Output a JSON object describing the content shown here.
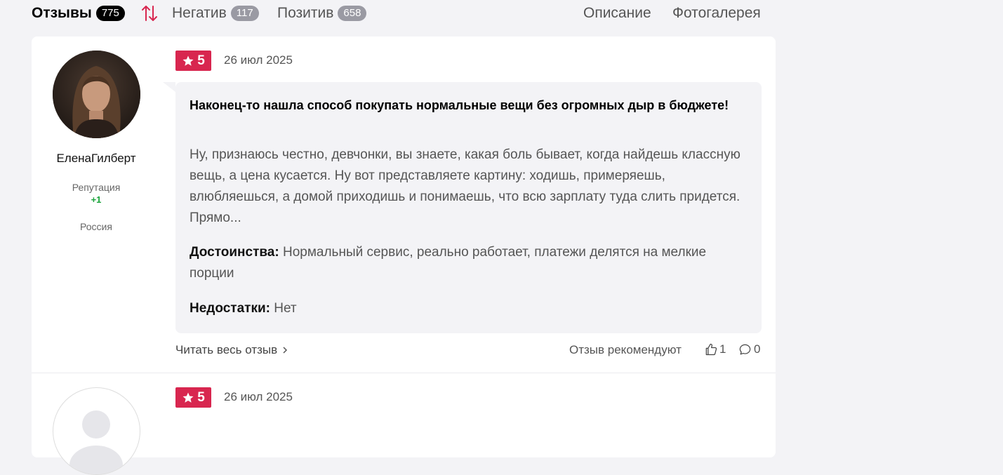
{
  "tabs": {
    "reviews_label": "Отзывы",
    "reviews_count": "775",
    "negative_label": "Негатив",
    "negative_count": "117",
    "positive_label": "Позитив",
    "positive_count": "658",
    "description_label": "Описание",
    "gallery_label": "Фотогалерея"
  },
  "colors": {
    "rating_bg": "#d8264f",
    "sort_icon": "#d8264f",
    "reputation": "#1aa33b"
  },
  "reviews": [
    {
      "author": "ЕленаГилберт",
      "reputation_label": "Репутация",
      "reputation_value": "+1",
      "country": "Россия",
      "rating": "5",
      "date": "26 июл 2025",
      "title": "Наконец-то нашла способ покупать нормальные вещи без огромных дыр в бюджете!",
      "text": "Ну, признаюсь честно, девчонки, вы знаете, какая боль бывает, когда найдешь классную вещь, а цена кусается. Ну вот представляете картину: ходишь, примеряешь, влюбляешься, а домой приходишь и понимаешь, что всю зарплату туда слить придется. Прямо...",
      "pros_label": "Достоинства:",
      "pros": "Нормальный сервис, реально работает, платежи делятся на мелкие порции",
      "cons_label": "Недостатки:",
      "cons": "Нет",
      "read_more": "Читать весь отзыв",
      "recommend_label": "Отзыв рекомендуют",
      "likes": "1",
      "comments": "0"
    },
    {
      "rating": "5",
      "date": "26 июл 2025"
    }
  ]
}
